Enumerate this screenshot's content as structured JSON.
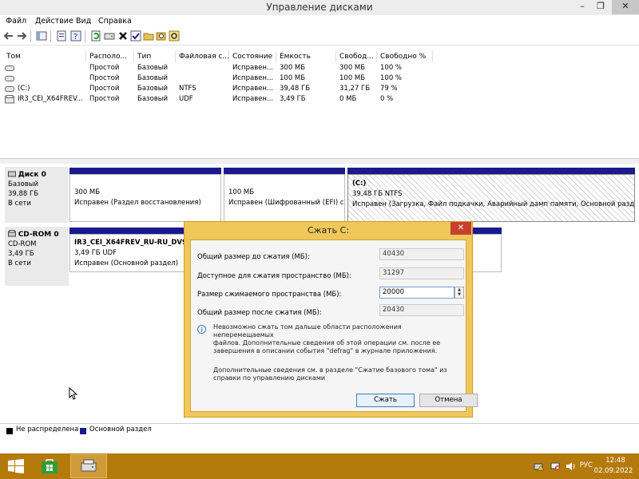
{
  "window": {
    "title": "Управление дисками",
    "min_glyph": "–",
    "max_glyph": "❐",
    "close_glyph": "✕"
  },
  "menu": [
    "Файл",
    "Действие",
    "Вид",
    "Справка"
  ],
  "volumes": {
    "columns": [
      "Том",
      "Располо...",
      "Тип",
      "Файловая с...",
      "Состояние",
      "Емкость",
      "Свобод...",
      "Свободно %"
    ],
    "rows": [
      [
        "",
        "Простой",
        "Базовый",
        "",
        "Исправен...",
        "300 МБ",
        "300 МБ",
        "100 %"
      ],
      [
        "",
        "Простой",
        "Базовый",
        "",
        "Исправен...",
        "100 МБ",
        "100 МБ",
        "100 %"
      ],
      [
        "(C:)",
        "Простой",
        "Базовый",
        "NTFS",
        "Исправен...",
        "39,48 ГБ",
        "31,27 ГБ",
        "79 %"
      ],
      [
        "IR3_CEI_X64FREV...",
        "Простой",
        "Базовый",
        "UDF",
        "Исправен...",
        "3,49 ГБ",
        "0 МБ",
        "0 %"
      ]
    ]
  },
  "disk0": {
    "name": "Диск 0",
    "type": "Базовый",
    "size": "39,88 ГБ",
    "status": "В сети",
    "parts": [
      {
        "title": "",
        "size": "300 МБ",
        "status": "Исправен (Раздел восстановления)"
      },
      {
        "title": "",
        "size": "100 МБ",
        "status": "Исправен (Шифрованный (EFI) си"
      },
      {
        "title": "(C:)",
        "size": "39,48 ГБ NTFS",
        "status": "Исправен (Загрузка, Файл подкачки, Аварийный дамп памяти, Основной разде"
      }
    ]
  },
  "cdrom0": {
    "name": "CD-ROM 0",
    "type": "CD-ROM",
    "size": "3,49 ГБ",
    "status": "В сети",
    "part": {
      "title": "IR3_CEI_X64FREV_RU-RU_DV9",
      "size": "3,49 ГБ UDF",
      "status": "Исправен (Основной раздел)"
    }
  },
  "legend": {
    "unallocated": "Не распределена",
    "primary": "Основной раздел"
  },
  "dialog": {
    "title": "Сжать C:",
    "close_glyph": "✕",
    "fields": [
      {
        "label": "Общий размер до сжатия (МБ):",
        "value": "40430"
      },
      {
        "label": "Доступное для сжатия пространство (МБ):",
        "value": "31297"
      },
      {
        "label": "Размер сжимаемого пространства (МБ):",
        "value": "20000"
      },
      {
        "label": "Общий размер после сжатия (МБ):",
        "value": "20430"
      }
    ],
    "info_line1": "Невозможно сжать том дальше области расположения неперемещаемых",
    "info_line2": "файлов. Дополнительные сведения об этой операции см. после ее",
    "info_line3": "завершения в описании события \"defrag\" в журнале приложения.",
    "more_line1": "Дополнительные сведения см. в разделе \"Сжатие базового тома\" из",
    "more_line2": "справки по управлению дисками",
    "shrink_label": "Сжать",
    "cancel_label": "Отмена"
  },
  "taskbar": {
    "lang": "РУС",
    "time": "12:48",
    "date": "02.09.2022"
  },
  "colors": {
    "accent": "#f0c75a",
    "taskbar": "#b47a0c",
    "primary_partition": "#1a1a8c",
    "close_red": "#c7402e"
  }
}
